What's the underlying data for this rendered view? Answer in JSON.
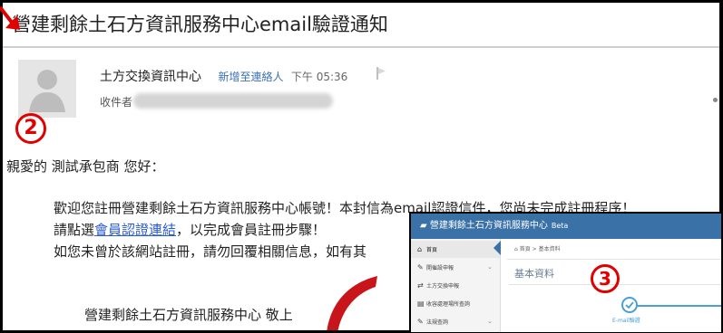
{
  "email": {
    "subject": "營建剩餘土石方資訊服務中心email驗證通知",
    "sender": "土方交換資訊中心",
    "add_contact": "新增至連絡人",
    "time": "下午 05:36",
    "recipient_label": "收件者",
    "greeting": "親愛的 測試承包商 您好：",
    "para1": "歡迎您註冊營建剩餘土石方資訊服務中心帳號！本封信為email認證信件，您尚未完成註冊程序！",
    "para2_pre": "請點選",
    "para2_link": "會員認證連結",
    "para2_post": "，以完成會員註冊步驟！",
    "para3": "如您未曾於該網站註冊，請勿回覆相關信息，如有其",
    "signature": "營建剩餘土石方資訊服務中心 敬上"
  },
  "annotations": {
    "step2": "2",
    "step3": "3",
    "marker_color": "#e10000"
  },
  "inset": {
    "brand": "營建剩餘土石方資訊服務中心",
    "beta": "Beta",
    "breadcrumb": "首頁 > 基本資料",
    "page_title": "基本資料",
    "step_label": "E-mail驗證",
    "nav_items": [
      {
        "label": "首頁",
        "icon": "home-icon",
        "has_children": false
      },
      {
        "label": "開催設申報",
        "icon": "wrench-icon",
        "has_children": true
      },
      {
        "label": "土方交換申報",
        "icon": "exchange-icon",
        "has_children": false
      },
      {
        "label": "收容處理場所查詢",
        "icon": "list-icon",
        "has_children": false
      },
      {
        "label": "法規查詢",
        "icon": "wrench-icon",
        "has_children": true
      }
    ]
  }
}
